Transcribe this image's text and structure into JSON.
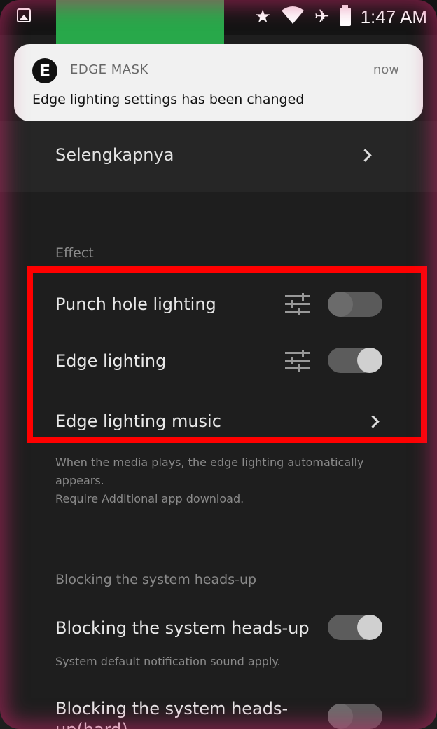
{
  "status_bar": {
    "time": "1:47 AM"
  },
  "notification": {
    "app_icon_letter": "E",
    "app_name": "EDGE MASK",
    "time": "now",
    "message": "Edge lighting settings has been changed"
  },
  "more_row": {
    "label": "Selengkapnya"
  },
  "effect_section": {
    "header": "Effect",
    "punch_hole": {
      "label": "Punch hole lighting",
      "enabled": false
    },
    "edge_lighting": {
      "label": "Edge lighting",
      "enabled": true
    },
    "edge_music": {
      "label": "Edge lighting music"
    },
    "description_line1": "When the media plays, the edge lighting automatically appears.",
    "description_line2": "Require Additional app download."
  },
  "blocking_section": {
    "header": "Blocking the system heads-up",
    "heads_up": {
      "label": "Blocking the system heads-up",
      "enabled": true,
      "subtext": "System default notification sound apply."
    },
    "heads_up_hard": {
      "label": "Blocking the system heads-up(hard)",
      "enabled": false
    }
  },
  "colors": {
    "highlight": "#ff0000",
    "edge_glow": "#d2286e",
    "notification_bg": "#f1f1f1"
  }
}
